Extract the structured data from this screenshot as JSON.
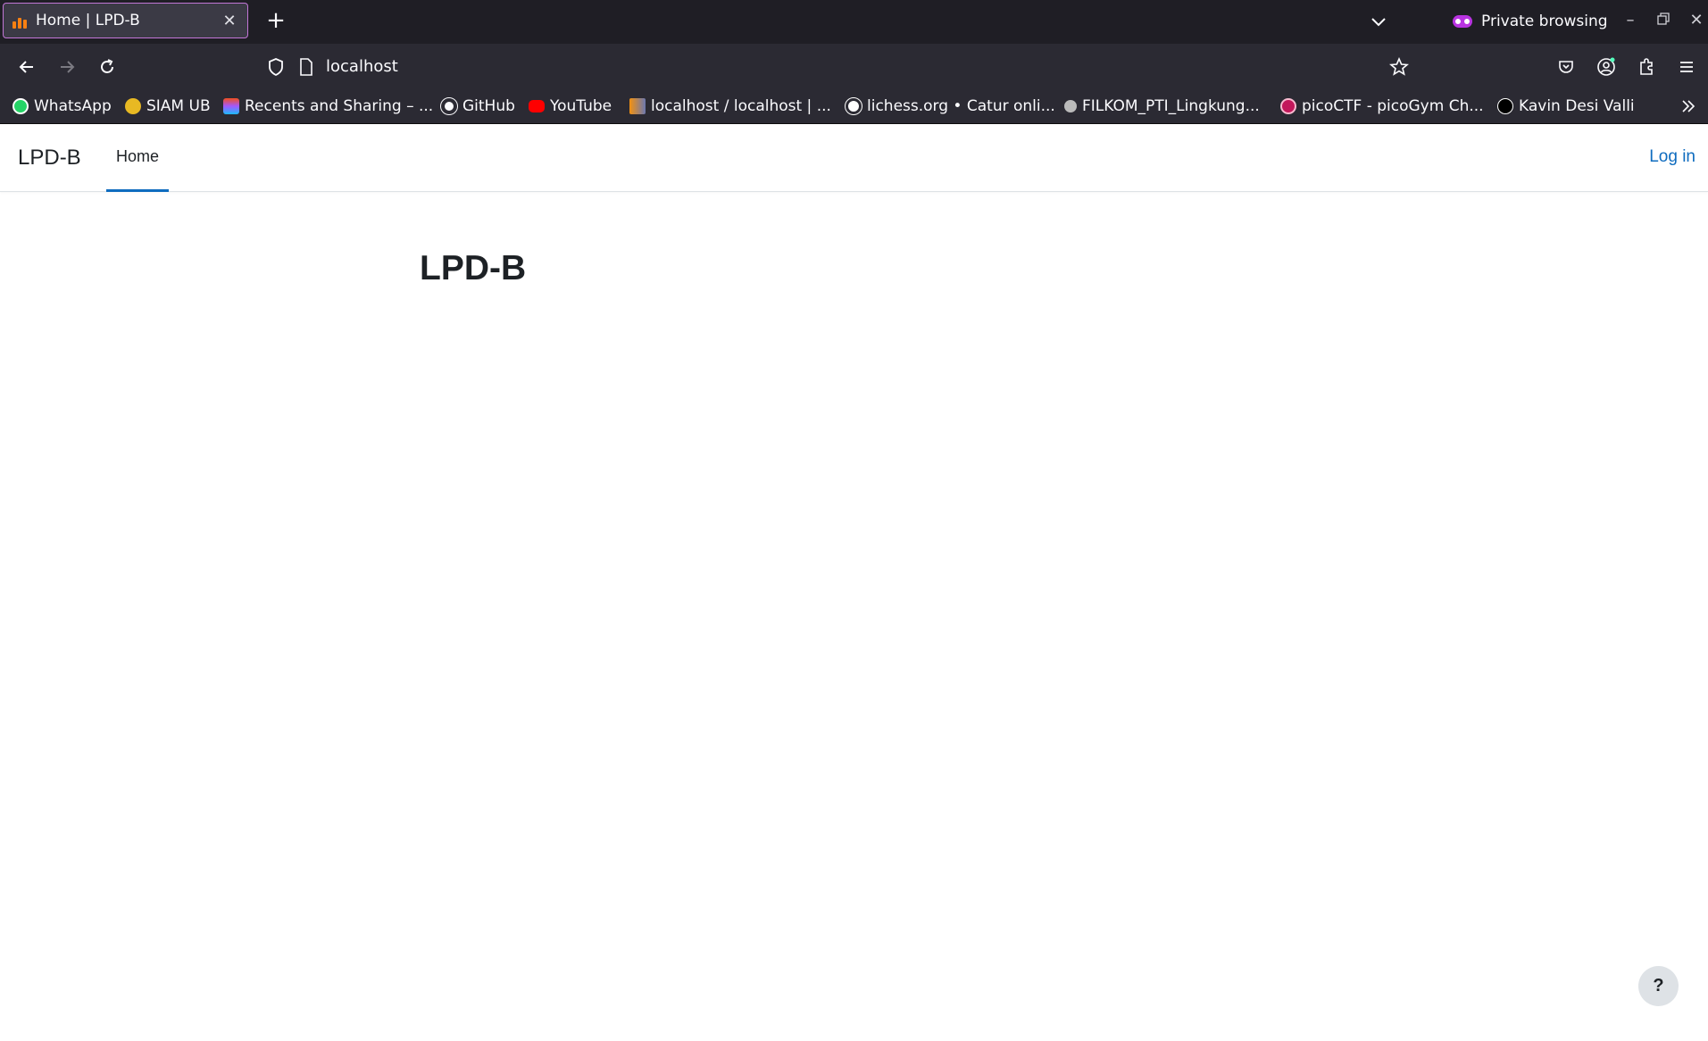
{
  "browser": {
    "tab": {
      "title": "Home | LPD-B"
    },
    "private_label": "Private browsing",
    "url": "localhost",
    "bookmarks": [
      {
        "label": "WhatsApp",
        "icon": "whatsapp-icon",
        "color": "#25d366"
      },
      {
        "label": "SIAM UB",
        "icon": "siam-ub-icon",
        "color": "#e8b923"
      },
      {
        "label": "Recents and Sharing – ...",
        "icon": "figma-icon",
        "color": "#a259ff"
      },
      {
        "label": "GitHub",
        "icon": "github-icon",
        "color": "#ffffff"
      },
      {
        "label": "YouTube",
        "icon": "youtube-icon",
        "color": "#ff0000"
      },
      {
        "label": "localhost / localhost | ...",
        "icon": "phpmyadmin-icon",
        "color": "#f29111"
      },
      {
        "label": "lichess.org • Catur onli...",
        "icon": "lichess-icon",
        "color": "#ffffff"
      },
      {
        "label": "FILKOM_PTI_Lingkung...",
        "icon": "filkom-icon",
        "color": "#cccccc"
      },
      {
        "label": "picoCTF - picoGym Ch...",
        "icon": "picoctf-icon",
        "color": "#c2185b"
      },
      {
        "label": "Kavin Desi Valli",
        "icon": "triangle-icon",
        "color": "#ffffff"
      }
    ]
  },
  "site": {
    "brand": "LPD-B",
    "nav_home": "Home",
    "login": "Log in",
    "heading": "LPD-B",
    "help": "?"
  },
  "colors": {
    "accent": "#0f6cbf",
    "chrome_dark": "#1f1e25",
    "toolbar": "#2b2a33"
  }
}
